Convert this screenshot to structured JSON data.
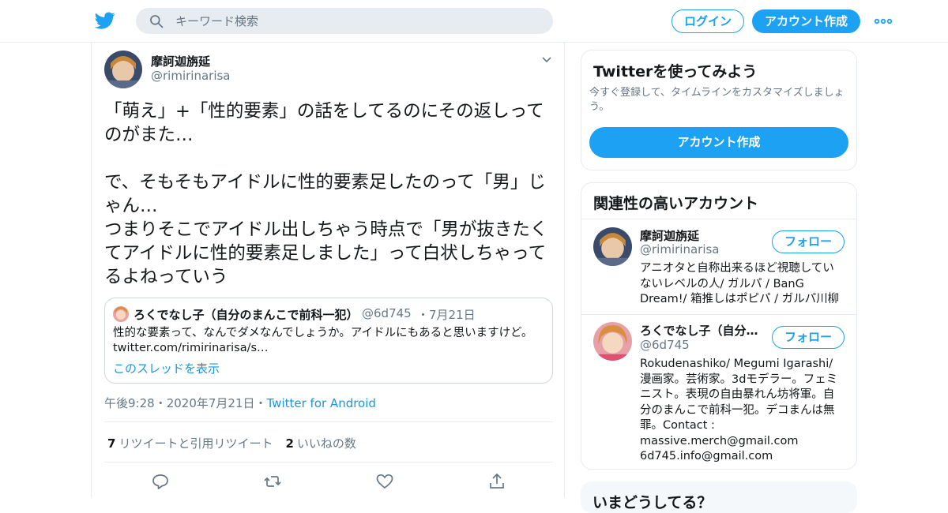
{
  "header": {
    "search_placeholder": "キーワード検索",
    "login_label": "ログイン",
    "signup_label": "アカウント作成"
  },
  "tweet": {
    "author_name": "摩訶迦旃延",
    "author_handle": "@rimirinarisa",
    "text": "「萌え」+「性的要素」の話をしてるのにその返しってのがまた…\n\nで、そもそもアイドルに性的要素足したのって「男」じゃん…\nつまりそこでアイドル出しちゃう時点で「男が抜きたくてアイドルに性的要素足しました」って白状しちゃってるよねっていう",
    "quote": {
      "name": "ろくでなし子（自分のまんこで前科一犯）",
      "handle": "@6d745",
      "date": "・7月21日",
      "text": "性的な要素って、なんでダメなんでしょうか。アイドルにもあると思いますけど。",
      "link": "twitter.com/rimirinarisa/s…",
      "thread_label": "このスレッドを表示"
    },
    "time": "午後9:28",
    "date": "・2020年7月21日・",
    "source": "Twitter for Android",
    "retweets_count": "7",
    "retweets_label": "リツイートと引用リツイート",
    "likes_count": "2",
    "likes_label": "いいねの数"
  },
  "sidebar": {
    "try_title": "Twitterを使ってみよう",
    "try_sub": "今すぐ登録して、タイムラインをカスタマイズしましょう。",
    "signup_label": "アカウント作成",
    "related_title": "関連性の高いアカウント",
    "accounts": [
      {
        "name": "摩訶迦旃延",
        "handle": "@rimirinarisa",
        "follow_label": "フォロー",
        "bio": "アニオタと自称出来るほど視聴していないレベルの人/ ガルパ / BanG Dream!/ 箱推しはポピパ / ガルパ川柳"
      },
      {
        "name": "ろくでなし子（自分…",
        "handle": "@6d745",
        "follow_label": "フォロー",
        "bio": "Rokudenashiko/ Megumi Igarashi/ 漫画家。芸術家。3dモデラー。フェミニスト。表現の自由暴れん坊将軍。自分のまんこで前科一犯。デコまんは無罪。Contact : massive.merch@gmail.com 6d745.info@gmail.com"
      }
    ],
    "whats_happening": "いまどうしてる？"
  },
  "colors": {
    "accent": "#1da1f2",
    "link": "#1b95e0",
    "muted": "#657786",
    "border": "#e6ecf0"
  }
}
